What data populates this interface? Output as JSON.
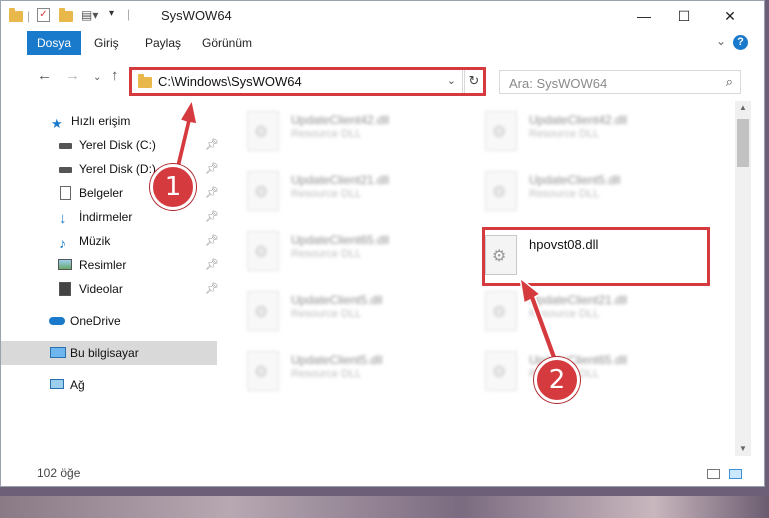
{
  "window": {
    "title": "SysWOW64"
  },
  "ribbon": {
    "tabs": [
      "Dosya",
      "Giriş",
      "Paylaş",
      "Görünüm"
    ],
    "help": "?"
  },
  "nav": {
    "address": "C:\\Windows\\SysWOW64",
    "search_placeholder": "Ara: SysWOW64"
  },
  "sidebar": {
    "items": [
      {
        "label": "Hızlı erişim",
        "icon": "star-icon"
      },
      {
        "label": "Yerel Disk (C:)",
        "icon": "drive-icon"
      },
      {
        "label": "Yerel Disk (D:)",
        "icon": "drive-icon"
      },
      {
        "label": "Belgeler",
        "icon": "documents-icon"
      },
      {
        "label": "İndirmeler",
        "icon": "download-icon"
      },
      {
        "label": "Müzik",
        "icon": "music-icon"
      },
      {
        "label": "Resimler",
        "icon": "pictures-icon"
      },
      {
        "label": "Videolar",
        "icon": "video-icon"
      },
      {
        "label": "OneDrive",
        "icon": "cloud-icon"
      },
      {
        "label": "Bu bilgisayar",
        "icon": "computer-icon"
      },
      {
        "label": "Ağ",
        "icon": "network-icon"
      }
    ]
  },
  "files": {
    "left": [
      {
        "name": "UpdateClient42.dll",
        "type": "Resource DLL"
      },
      {
        "name": "UpdateClient21.dll",
        "type": "Resource DLL"
      },
      {
        "name": "UpdateClient65.dll",
        "type": "Resource DLL"
      },
      {
        "name": "UpdateClient5.dll",
        "type": "Resource DLL"
      },
      {
        "name": "UpdateClient5.dll",
        "type": "Resource DLL"
      }
    ],
    "right": [
      {
        "name": "UpdateClient42.dll",
        "type": "Resource DLL"
      },
      {
        "name": "UpdateClient5.dll",
        "type": "Resource DLL"
      },
      {
        "name": "hpovst08.dll",
        "type": ""
      },
      {
        "name": "UpdateClient21.dll",
        "type": "Resource DLL"
      },
      {
        "name": "UpdateClient65.dll",
        "type": "Resource DLL"
      }
    ]
  },
  "status": {
    "count": "102 öğe"
  },
  "annotations": {
    "step1": "1",
    "step2": "2",
    "color": "#d53a3f"
  },
  "colors": {
    "accent": "#1979ca",
    "highlight": "#d53a3f"
  }
}
